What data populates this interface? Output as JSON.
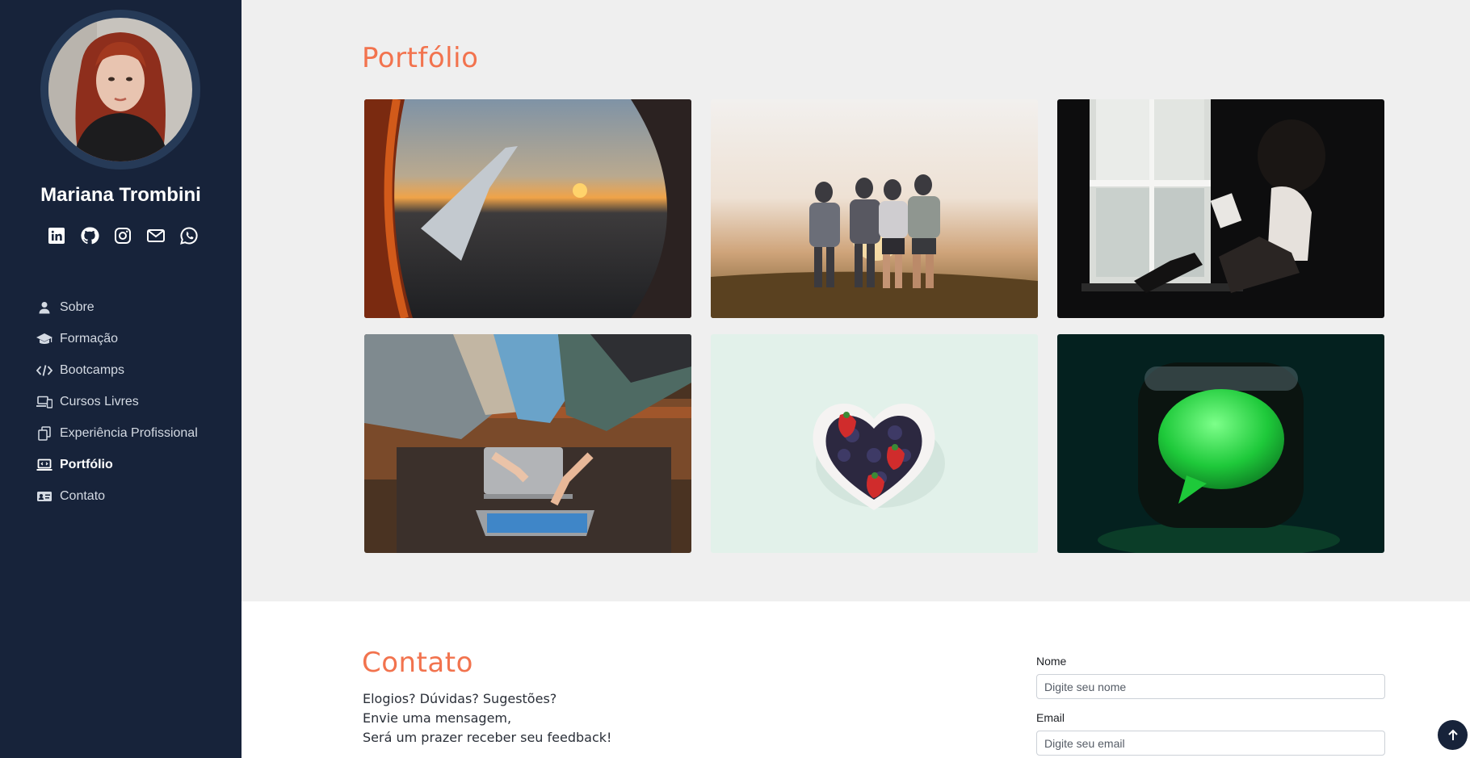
{
  "profile": {
    "name": "Mariana Trombini"
  },
  "socials": [
    {
      "icon": "linkedin-icon"
    },
    {
      "icon": "github-icon"
    },
    {
      "icon": "instagram-icon"
    },
    {
      "icon": "mail-icon"
    },
    {
      "icon": "whatsapp-icon"
    }
  ],
  "nav": {
    "items": [
      {
        "label": "Sobre",
        "icon": "user-icon"
      },
      {
        "label": "Formação",
        "icon": "graduation-cap-icon"
      },
      {
        "label": "Bootcamps",
        "icon": "code-icon"
      },
      {
        "label": "Cursos Livres",
        "icon": "laptop-phone-icon"
      },
      {
        "label": "Experiência Profissional",
        "icon": "documents-icon"
      },
      {
        "label": "Portfólio",
        "icon": "laptop-code-icon",
        "active": true
      },
      {
        "label": "Contato",
        "icon": "id-card-icon"
      }
    ]
  },
  "portfolio": {
    "title": "Portfólio",
    "items": [
      {
        "name": "sunset-airplane-window"
      },
      {
        "name": "friends-sunset-hill"
      },
      {
        "name": "woman-reading-window"
      },
      {
        "name": "team-laptop-hands"
      },
      {
        "name": "heart-bowl-berries"
      },
      {
        "name": "green-message-bubble"
      }
    ]
  },
  "contact": {
    "title": "Contato",
    "line1": "Elogios? Dúvidas? Sugestões?",
    "line2": "Envie uma mensagem,",
    "line3": "Será um prazer receber seu feedback!",
    "name_label": "Nome",
    "name_placeholder": "Digite seu nome",
    "email_label": "Email",
    "email_placeholder": "Digite seu email"
  },
  "colors": {
    "sidebar": "#17233a",
    "accent": "#f2734e",
    "page_bg": "#efefef"
  }
}
